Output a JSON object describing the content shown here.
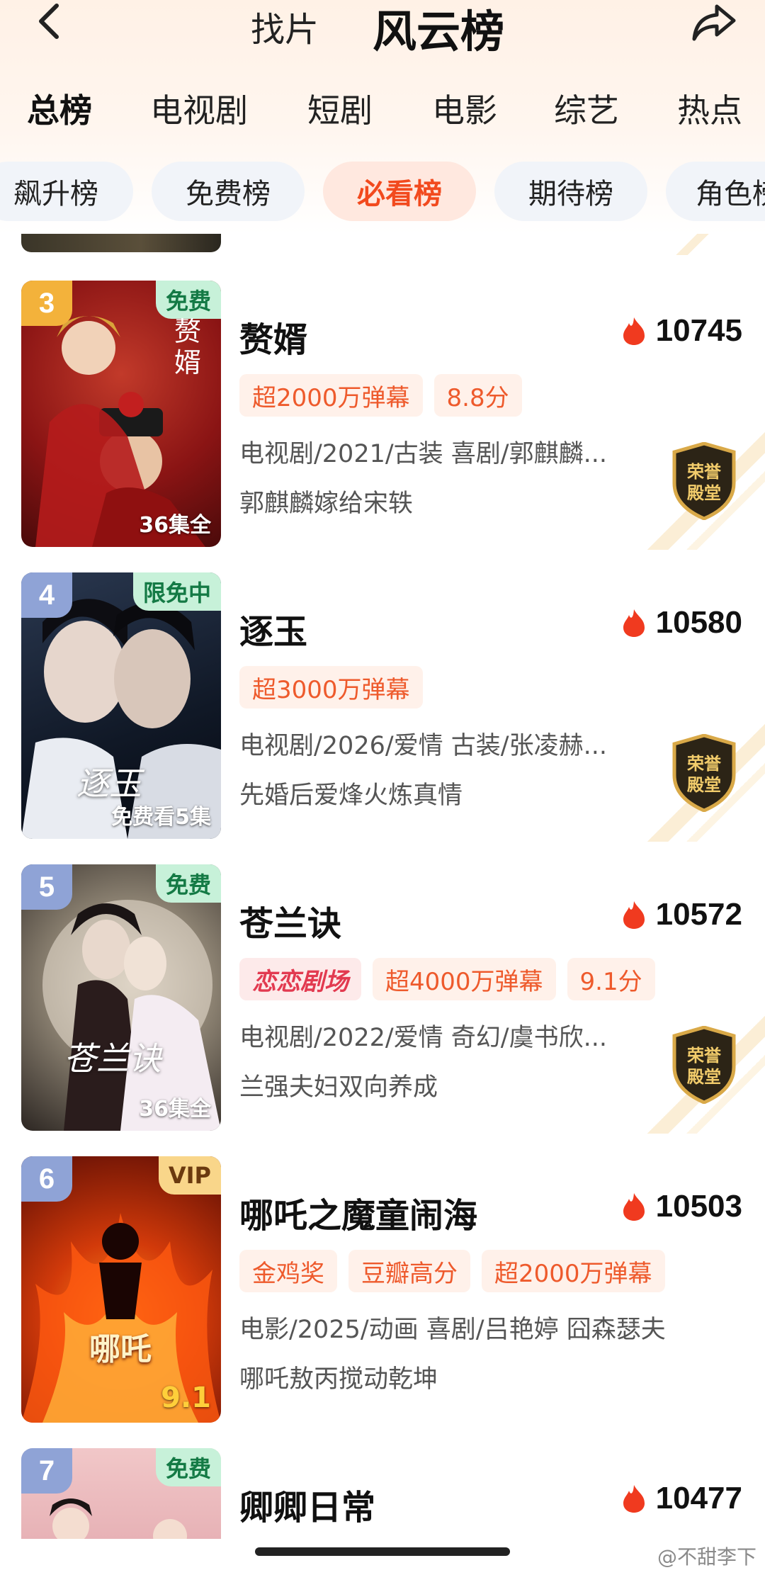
{
  "header": {
    "tab_find": "找片",
    "tab_ranking": "风云榜"
  },
  "categories": [
    "总榜",
    "电视剧",
    "短剧",
    "电影",
    "综艺",
    "热点"
  ],
  "active_category": "总榜",
  "sub_tabs": [
    "飙升榜",
    "免费榜",
    "必看榜",
    "期待榜",
    "角色榜"
  ],
  "active_sub_tab": "必看榜",
  "items": [
    {
      "rank": "3",
      "badge": "免费",
      "poster_foot": "36集全",
      "poster_title": "赘婿",
      "title": "赘婿",
      "heat": "10745",
      "tags": [
        "超2000万弹幕",
        "8.8分"
      ],
      "meta": "电视剧/2021/古装 喜剧/郭麒麟...",
      "desc": "郭麒麟嫁给宋轶"
    },
    {
      "rank": "4",
      "badge": "限免中",
      "poster_foot": "免费看5集",
      "poster_title": "逐玉",
      "title": "逐玉",
      "heat": "10580",
      "tags": [
        "超3000万弹幕"
      ],
      "meta": "电视剧/2026/爱情 古装/张凌赫...",
      "desc": "先婚后爱烽火炼真情"
    },
    {
      "rank": "5",
      "badge": "免费",
      "poster_foot": "36集全",
      "poster_title": "苍兰诀",
      "title": "苍兰诀",
      "heat": "10572",
      "logo_tag": "恋恋剧场",
      "tags": [
        "超4000万弹幕",
        "9.1分"
      ],
      "meta": "电视剧/2022/爱情 奇幻/虞书欣...",
      "desc": "兰强夫妇双向养成"
    },
    {
      "rank": "6",
      "badge": "VIP",
      "poster_foot": "9.1",
      "poster_title": "哪吒",
      "title": "哪吒之魔童闹海",
      "heat": "10503",
      "tags": [
        "金鸡奖",
        "豆瓣高分",
        "超2000万弹幕"
      ],
      "meta": "电影/2025/动画 喜剧/吕艳婷 囧森瑟夫",
      "desc": "哪吒敖丙搅动乾坤"
    },
    {
      "rank": "7",
      "badge": "免费",
      "title": "卿卿日常",
      "heat": "10477"
    }
  ],
  "honor_badge": "荣誉殿堂",
  "watermark": "@不甜李下",
  "colors": {
    "accent": "#f24a1e",
    "tag_bg": "#fff1ea",
    "free_badge": "#c7f1d9",
    "rank_gold": "#f3b23b",
    "rank_blue": "#8fa3d6"
  }
}
